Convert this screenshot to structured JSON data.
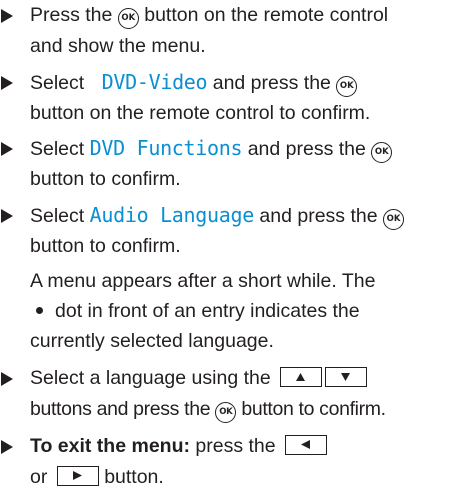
{
  "steps": [
    {
      "prefix": "Press the",
      "key": "OK",
      "suffix": "button on the remote control",
      "line2": "and show the menu."
    },
    {
      "prefix": "Select",
      "menu_item": "DVD-Video",
      "middle": "and press the",
      "key": "OK",
      "line2": "button on the remote control to confirm."
    },
    {
      "prefix": "Select",
      "menu_item": "DVD Functions",
      "middle": "and press the",
      "key": "OK",
      "line2": "button to confirm."
    },
    {
      "prefix": "Select",
      "menu_item": "Audio Language",
      "middle": "and press the",
      "key": "OK",
      "line2": "button to confirm.",
      "note_line1": "A menu appears after a short while. The",
      "note_line2": "dot in front of an entry indicates the",
      "note_line3": "currently selected language."
    },
    {
      "prefix": "Select a language using the",
      "line2_prefix": "buttons and press the",
      "key": "OK",
      "line2_suffix": "button to confirm."
    },
    {
      "bold_label": "To exit the menu:",
      "prefix": "press the",
      "line2_prefix": "or",
      "line2_suffix": "button."
    }
  ],
  "colors": {
    "text": "#231f20",
    "menu_item": "#0a8fd3"
  },
  "icons": {
    "bullet": "triangle-right-icon",
    "ok_button": "ok-button-icon",
    "up_key": "up-arrow-key-icon",
    "down_key": "down-arrow-key-icon",
    "left_key": "left-arrow-key-icon",
    "right_key": "right-arrow-key-icon",
    "selection_dot": "selection-dot-icon"
  }
}
